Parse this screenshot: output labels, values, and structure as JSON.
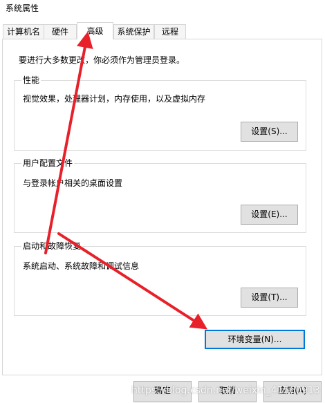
{
  "window": {
    "title": "系统属性"
  },
  "tabs": [
    {
      "label": "计算机名",
      "active": false
    },
    {
      "label": "硬件",
      "active": false
    },
    {
      "label": "高级",
      "active": true
    },
    {
      "label": "系统保护",
      "active": false
    },
    {
      "label": "远程",
      "active": false
    }
  ],
  "advanced": {
    "notice": "要进行大多数更改，你必须作为管理员登录。",
    "performance": {
      "title": "性能",
      "desc": "视觉效果，处理器计划，内存使用，以及虚拟内存",
      "button": "设置(S)..."
    },
    "user_profiles": {
      "title": "用户配置文件",
      "desc": "与登录帐户相关的桌面设置",
      "button": "设置(E)..."
    },
    "startup_recovery": {
      "title": "启动和故障恢复",
      "desc": "系统启动、系统故障和调试信息",
      "button": "设置(T)..."
    },
    "env_button": "环境变量(N)..."
  },
  "footer": {
    "ok": "确定",
    "cancel": "取消",
    "apply": "应用(A)"
  },
  "watermark": "https://blog.csdn.net/weixin_41560913",
  "colors": {
    "annotation_arrow": "#e8202a",
    "focus_border": "#0078d7",
    "button_bg": "#e1e1e1"
  }
}
